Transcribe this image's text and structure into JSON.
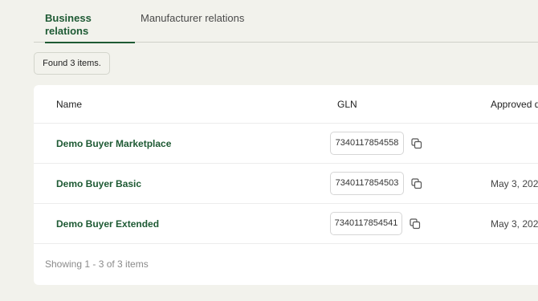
{
  "tabs": [
    {
      "label": "Business relations",
      "active": true
    },
    {
      "label": "Manufacturer relations",
      "active": false
    }
  ],
  "found_badge": "Found 3 items.",
  "table": {
    "columns": [
      "Name",
      "GLN",
      "Approved d"
    ],
    "rows": [
      {
        "name": "Demo Buyer Marketplace",
        "gln": "7340117854558",
        "approved": ""
      },
      {
        "name": "Demo Buyer Basic",
        "gln": "7340117854503",
        "approved": "May 3, 202"
      },
      {
        "name": "Demo Buyer Extended",
        "gln": "7340117854541",
        "approved": "May 3, 202"
      }
    ]
  },
  "footer": "Showing 1 - 3 of 3 items",
  "colors": {
    "accent": "#1e5a34",
    "background": "#f2f2ec"
  },
  "icons": {
    "copy": "copy-icon"
  }
}
